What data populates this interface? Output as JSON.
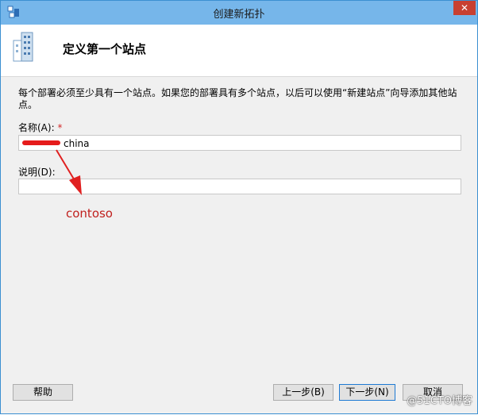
{
  "window": {
    "title": "创建新拓扑",
    "close_label": "✕"
  },
  "header": {
    "title": "定义第一个站点"
  },
  "description": "每个部署必须至少具有一个站点。如果您的部署具有多个站点，以后可以使用“新建站点”向导添加其他站点。",
  "name_field": {
    "label": "名称(A):",
    "required_mark": "*",
    "value": "china"
  },
  "desc_field": {
    "label": "说明(D):",
    "value": ""
  },
  "annotation": "contoso",
  "buttons": {
    "help": "帮助",
    "back": "上一步(B)",
    "next": "下一步(N)",
    "cancel": "取消"
  },
  "watermark": "@51CTO博客"
}
